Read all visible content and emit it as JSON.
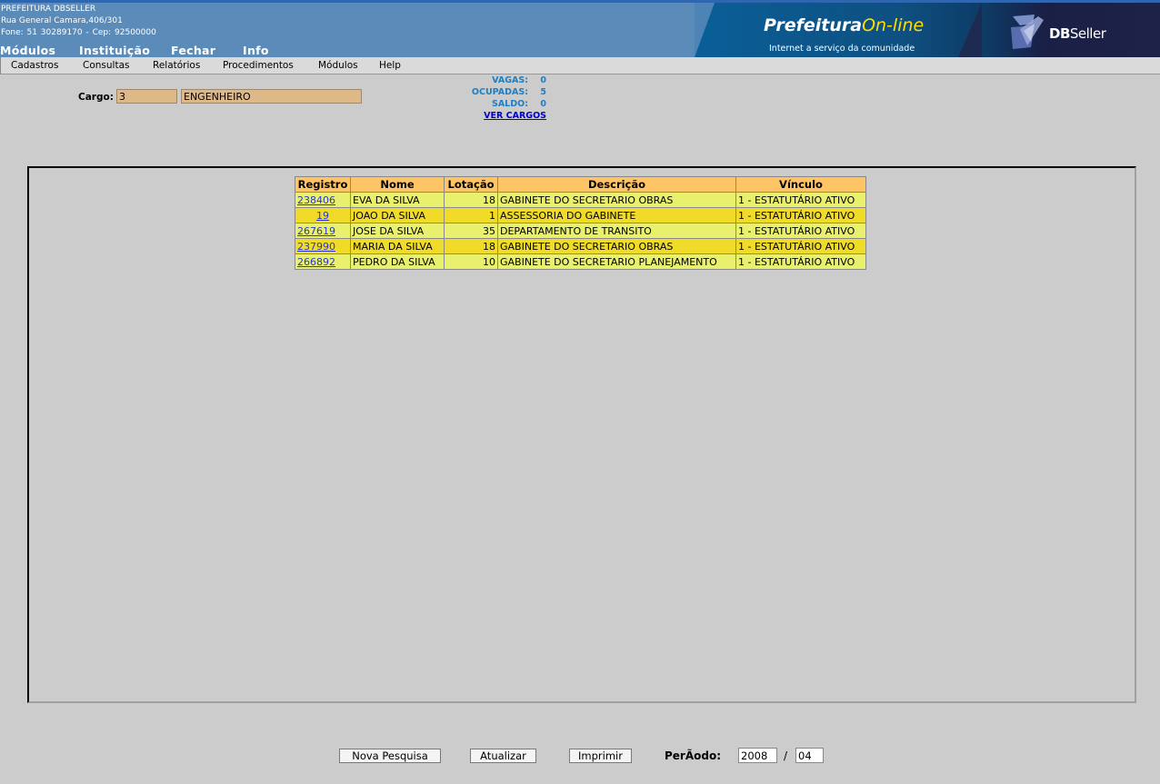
{
  "header": {
    "org_name": "PREFEITURA DBSELLER",
    "address": "Rua General Camara,406/301",
    "phone_line": "Fone: 51 30289170  -  Cep: 92500000",
    "top_menu": [
      "Módulos",
      "Instituição",
      "Fechar",
      "Info"
    ],
    "banner": {
      "prefeitura": "Prefeitura",
      "online": "On-line",
      "tagline": "Internet a serviço da comunidade",
      "dbseller_bold": "DB",
      "dbseller_rest": "Seller"
    }
  },
  "submenu": [
    "Cadastros",
    "Consultas",
    "Relatórios",
    "Procedimentos",
    "Módulos",
    "Help"
  ],
  "cargo": {
    "label": "Cargo:",
    "code": "3",
    "description": "ENGENHEIRO"
  },
  "stats": {
    "vagas_label": "VAGAS:",
    "vagas": "0",
    "ocupadas_label": "OCUPADAS:",
    "ocupadas": "5",
    "saldo_label": "SALDO:",
    "saldo": "0",
    "ver_cargos": "VER CARGOS"
  },
  "table": {
    "headers": [
      "Registro",
      "Nome",
      "Lotação",
      "Descrição",
      "Vínculo"
    ],
    "rows": [
      {
        "registro": "238406",
        "nome": "EVA DA SILVA",
        "lotacao": "18",
        "descricao": "GABINETE DO SECRETARIO OBRAS",
        "vinculo": "1 - ESTATUTÁRIO ATIVO"
      },
      {
        "registro": "19",
        "nome": "JOAO DA SILVA",
        "lotacao": "1",
        "descricao": "ASSESSORIA DO GABINETE",
        "vinculo": "1 - ESTATUTÁRIO ATIVO"
      },
      {
        "registro": "267619",
        "nome": "JOSE DA SILVA",
        "lotacao": "35",
        "descricao": "DEPARTAMENTO DE TRANSITO",
        "vinculo": "1 - ESTATUTÁRIO ATIVO"
      },
      {
        "registro": "237990",
        "nome": "MARIA DA SILVA",
        "lotacao": "18",
        "descricao": "GABINETE DO SECRETARIO OBRAS",
        "vinculo": "1 - ESTATUTÁRIO ATIVO"
      },
      {
        "registro": "266892",
        "nome": "PEDRO DA SILVA",
        "lotacao": "10",
        "descricao": "GABINETE DO SECRETARIO PLANEJAMENTO",
        "vinculo": "1 - ESTATUTÁRIO ATIVO"
      }
    ]
  },
  "footer": {
    "nova_pesquisa": "Nova Pesquisa",
    "atualizar": "Atualizar",
    "imprimir": "Imprimir",
    "periodo_label": "PerÃodo:",
    "ano": "2008",
    "separator": "/",
    "mes": "04"
  },
  "colors": {
    "header_bg": "#5b8bb9",
    "table_header_bg": "#ffc466",
    "row_odd_bg": "#e8f06e",
    "row_even_bg": "#f0dc28",
    "cargo_input_bg": "#deb887",
    "stats_text": "#1e7fc4",
    "link": "#2a37c4"
  }
}
